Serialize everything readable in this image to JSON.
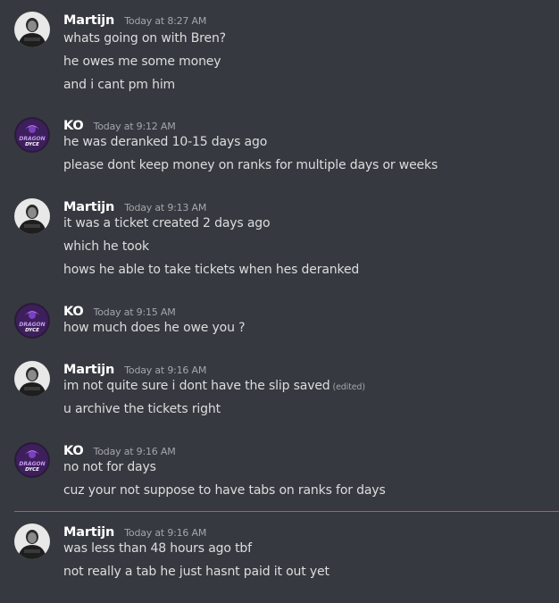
{
  "colors": {
    "background": "#36393f",
    "username": "#ffffff",
    "timestamp": "#a3a6aa",
    "message_text": "#dcddde",
    "new_messages_divider": "#ed4245"
  },
  "users": {
    "martijn": {
      "name": "Martijn",
      "avatar_icon": "martijn-avatar-icon"
    },
    "ko": {
      "name": "KO",
      "avatar_icon": "dragon-dyce-avatar-icon",
      "avatar_text_line1": "DRAGON",
      "avatar_text_line2": "DYCE"
    }
  },
  "groups": [
    {
      "author": "Martijn",
      "timestamp": "Today at 8:27 AM",
      "messages": [
        "whats going on with Bren?",
        "he owes me some money",
        "and i cant pm him"
      ]
    },
    {
      "author": "KO",
      "timestamp": "Today at 9:12 AM",
      "messages": [
        "he was deranked 10-15 days ago",
        "please dont keep money on ranks for multiple days or weeks"
      ]
    },
    {
      "author": "Martijn",
      "timestamp": "Today at 9:13 AM",
      "messages": [
        "it was a ticket created 2 days ago",
        "which he took",
        "hows he able to take tickets when hes deranked"
      ]
    },
    {
      "author": "KO",
      "timestamp": "Today at 9:15 AM",
      "messages": [
        "how much does he owe you ?"
      ]
    },
    {
      "author": "Martijn",
      "timestamp": "Today at 9:16 AM",
      "messages": [
        "im not quite sure i dont have the slip saved",
        "u archive the tickets right"
      ],
      "edited_label": "(edited)"
    },
    {
      "author": "KO",
      "timestamp": "Today at 9:16 AM",
      "messages": [
        "no not for days",
        "cuz your not suppose to have tabs on ranks for days"
      ]
    },
    {
      "author": "Martijn",
      "timestamp": "Today at 9:16 AM",
      "messages": [
        "was less than 48 hours ago tbf",
        "not really a tab he just hasnt paid it out yet"
      ]
    }
  ]
}
